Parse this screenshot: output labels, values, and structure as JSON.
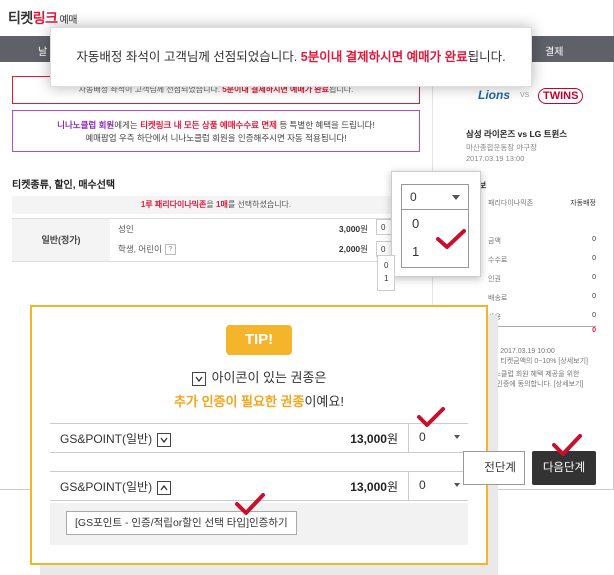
{
  "header": {
    "logo_part1": "티켓",
    "logo_part2": "링크",
    "logo_part3": "예매",
    "steps": [
      "날",
      "결제"
    ]
  },
  "modal": {
    "text_before": "자동배정 좌석이 고객님께 선점되었습니다. ",
    "text_highlight": "5분이내 결제하시면 예매가 완료",
    "text_after": "됩니다."
  },
  "notice": {
    "text_before": "자동배정 좌석이 고객님께 선점되었습니다. ",
    "text_highlight": "5분이내 결제하시면 예매가 완료",
    "text_after": "됩니다."
  },
  "promo": {
    "line1_a": "니나노클럽 회원",
    "line1_b": "에게는 ",
    "line1_c": "티켓링크 내 모든 상품 예매수수료 면제",
    "line1_d": " 등 특별한 혜택을 드립니다!",
    "line2": "예매팝업 우측 하단에서 니나노클럽 회원을 인증해주시면 자동 적용됩니다!"
  },
  "ticket_section": {
    "title": "티켓종류, 할인, 매수선택",
    "note_highlight": "1루 패리다이나믹존",
    "note_mid": "을 ",
    "note_count": "1매",
    "note_after": "를 선택하셨습니다.",
    "type_label": "일반(정가)",
    "rows": [
      {
        "label": "성인",
        "price": "3,000",
        "unit": "원",
        "qty": "0"
      },
      {
        "label": "학생, 어린이",
        "price": "2,000",
        "unit": "원",
        "qty": "0",
        "help": "?"
      }
    ]
  },
  "dropdown_zoom": {
    "selected": "0",
    "options": [
      "0",
      "1"
    ]
  },
  "right_panel": {
    "team_home": "Lions",
    "vs": "VS",
    "team_away": "TWINS",
    "game_title": "삼성 라이온즈 vs LG 트윈스",
    "venue": "마산종합운동장 야구장",
    "date": "2017.03.19 13:00",
    "info_header": "보",
    "info_rows": [
      {
        "label": "패리다이나믹존",
        "value": "자동배정"
      },
      {
        "label": "금액",
        "value": "0"
      },
      {
        "label": "수수료",
        "value": "0"
      },
      {
        "label": "인권",
        "value": "0"
      },
      {
        "label": "배송료",
        "value": "0"
      },
      {
        "label": "사용",
        "value": "0"
      }
    ],
    "total_value": "0",
    "cancel_deadline": "한 : 2017.03.19 10:00",
    "cancel_fee": "료 : 티켓금액의 0~10% [상세보기]",
    "club_line1": "니노클럽 회원 혜택 제공을 위한",
    "club_line2": "원 인증에 동의합니다. [상세보기]"
  },
  "tip": {
    "badge": "TIP!",
    "line1": "아이콘이 있는 권종은",
    "line2_highlight": "추가 인증이 필요한 권종",
    "line2_after": "이예요!",
    "rows": [
      {
        "name": "GS&POINT(일반)",
        "price": "13,000",
        "unit": "원",
        "qty": "0"
      },
      {
        "name": "GS&POINT(일반)",
        "price": "13,000",
        "unit": "원",
        "qty": "0"
      }
    ],
    "auth_button": "[GS포인트 - 인증/적립or할인 선택 타입]인증하기"
  },
  "footer": {
    "prev_label": "전단계",
    "next_label": "다음단계"
  },
  "colors": {
    "accent_red": "#e0193b",
    "tip_orange": "#f5b52a",
    "check_red": "#c8102e"
  }
}
